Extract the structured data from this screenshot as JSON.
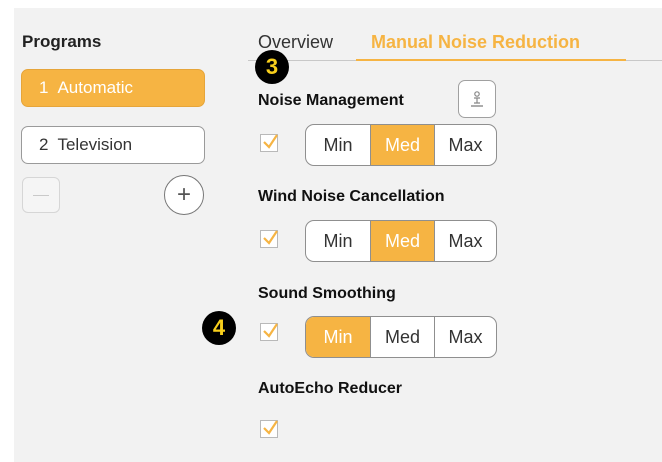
{
  "programs": {
    "title": "Programs",
    "items": [
      {
        "number": "1",
        "label": "Automatic",
        "active": true
      },
      {
        "number": "2",
        "label": "Television",
        "active": false
      }
    ],
    "add_symbol": "+"
  },
  "tabs": [
    {
      "label": "Overview",
      "active": false
    },
    {
      "label": "Manual Noise Reduction",
      "active": true
    }
  ],
  "callouts": [
    "3",
    "4"
  ],
  "sections": [
    {
      "title": "Noise Management",
      "checked": true,
      "options": [
        "Min",
        "Med",
        "Max"
      ],
      "selected": "Med"
    },
    {
      "title": "Wind Noise Cancellation",
      "checked": true,
      "options": [
        "Min",
        "Med",
        "Max"
      ],
      "selected": "Med"
    },
    {
      "title": "Sound Smoothing",
      "checked": true,
      "options": [
        "Min",
        "Med",
        "Max"
      ],
      "selected": "Min"
    },
    {
      "title": "AutoEcho Reducer",
      "checked": true
    }
  ],
  "colors": {
    "accent": "#f6b443",
    "callout_text": "#f8cf1c",
    "panel_bg": "#f2f2f2"
  },
  "icons": {
    "info_button": "person-info-icon",
    "checkbox": "check-icon"
  }
}
